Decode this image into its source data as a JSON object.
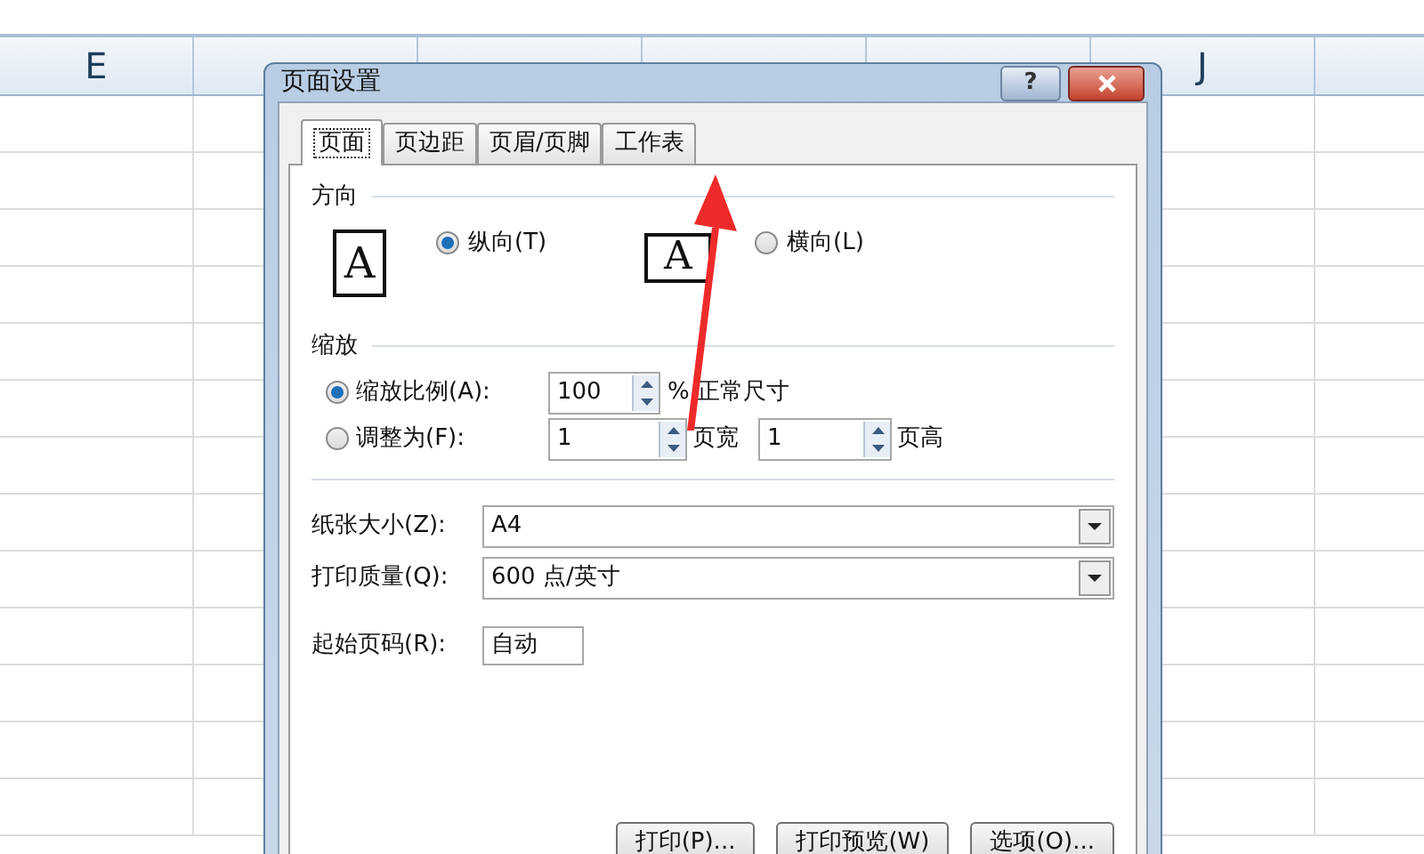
{
  "spreadsheet": {
    "first_column": "E",
    "last_column": "J"
  },
  "dialog": {
    "title": "页面设置",
    "help_button": "?",
    "tabs": [
      {
        "label": "页面",
        "selected": true
      },
      {
        "label": "页边距",
        "selected": false
      },
      {
        "label": "页眉/页脚",
        "selected": false
      },
      {
        "label": "工作表",
        "selected": false
      }
    ],
    "orientation": {
      "heading": "方向",
      "options": [
        {
          "kind": "portrait",
          "glyph": "A",
          "label": "纵向(T)",
          "selected": true
        },
        {
          "kind": "landscape",
          "glyph": "A",
          "label": "横向(L)",
          "selected": false
        }
      ]
    },
    "scaling": {
      "heading": "缩放",
      "rows": [
        {
          "kind": "percent",
          "label": "缩放比例(A):",
          "selected": true,
          "value": "100",
          "suffix": "% 正常尺寸"
        },
        {
          "kind": "fit",
          "label": "调整为(F):",
          "selected": false,
          "width_value": "1",
          "width_label": "页宽",
          "height_value": "1",
          "height_label": "页高"
        }
      ]
    },
    "paper_size": {
      "label": "纸张大小(Z):",
      "value": "A4"
    },
    "print_quality": {
      "label": "打印质量(Q):",
      "value": "600 点/英寸"
    },
    "first_page_number": {
      "label": "起始页码(R):",
      "value": "自动"
    },
    "buttons": [
      "打印(P)...",
      "打印预览(W)",
      "选项(O)..."
    ]
  }
}
